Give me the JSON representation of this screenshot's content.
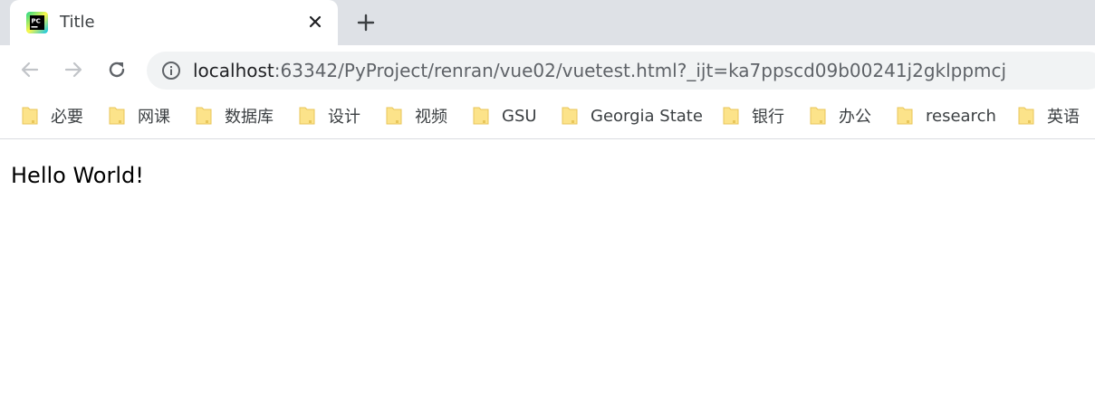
{
  "tab": {
    "title": "Title",
    "favicon": "pycharm-icon"
  },
  "toolbar": {
    "back_icon": "arrow-left-icon",
    "forward_icon": "arrow-right-icon",
    "reload_icon": "reload-icon"
  },
  "address": {
    "host": "localhost",
    "rest": ":63342/PyProject/renran/vue02/vuetest.html?_ijt=ka7ppscd09b00241j2gklppmcj",
    "info_icon": "info-icon"
  },
  "bookmarks": [
    {
      "label": "必要"
    },
    {
      "label": "网课"
    },
    {
      "label": "数据库"
    },
    {
      "label": "设计"
    },
    {
      "label": "视频"
    },
    {
      "label": "GSU"
    },
    {
      "label": "Georgia State"
    },
    {
      "label": "银行"
    },
    {
      "label": "办公"
    },
    {
      "label": "research"
    },
    {
      "label": "英语"
    }
  ],
  "page": {
    "heading": "Hello World!"
  },
  "colors": {
    "tab_strip": "#dee1e6",
    "omnibox": "#f1f3f4",
    "folder": "#fce38a"
  }
}
